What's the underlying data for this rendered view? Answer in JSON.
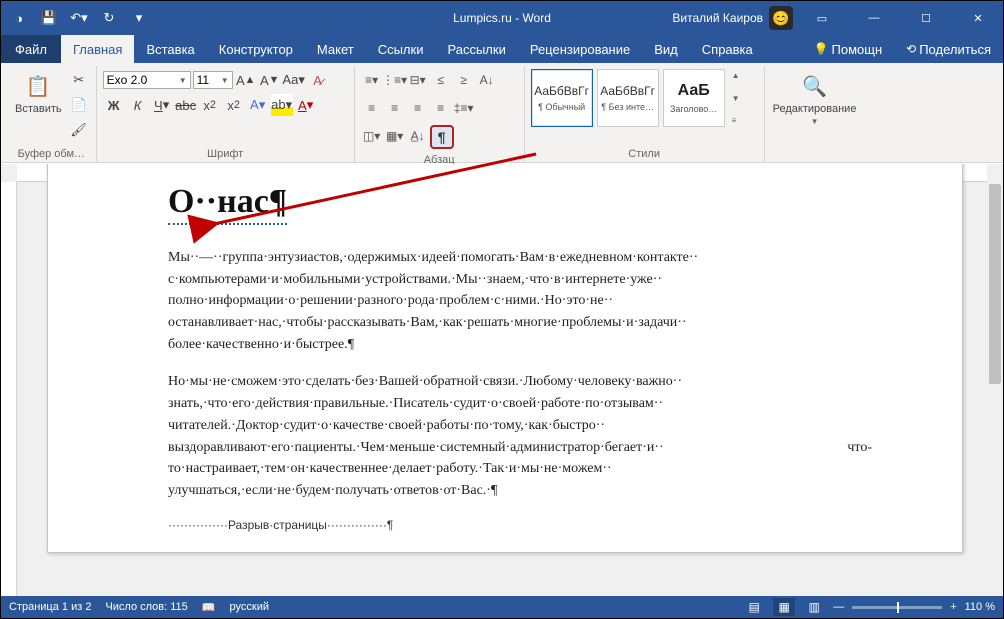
{
  "title": "Lumpics.ru  -  Word",
  "user": "Виталий Каиров",
  "tabs": {
    "file": "Файл",
    "home": "Главная",
    "insert": "Вставка",
    "design": "Конструктор",
    "layout": "Макет",
    "refs": "Ссылки",
    "mail": "Рассылки",
    "review": "Рецензирование",
    "view": "Вид",
    "help": "Справка",
    "assist": "Помощн",
    "share": "Поделиться"
  },
  "groups": {
    "clipboard": "Буфер обм…",
    "paste": "Вставить",
    "font": "Шрифт",
    "paragraph": "Абзац",
    "styles": "Стили",
    "editing": "Редактирование"
  },
  "font": {
    "name": "Exo 2.0",
    "size": "11"
  },
  "styles": {
    "preview": "АаБбВвГг",
    "normal": "¶ Обычный",
    "nospace": "¶ Без инте…",
    "h1preview": "АаБ",
    "h1": "Заголово…"
  },
  "doc": {
    "heading": "О··нас¶",
    "p1": "Мы··—··группа·энтузиастов,·одержимых·идеей·помогать·Вам·в·ежедневном·контакте·· с·компьютерами·и·мобильными·устройствами.·Мы··знаем,·что·в·интернете·уже·· полно·информации·о·решении·разного·рода·проблем·с·ними.·Но·это·не·· останавливает·нас,·чтобы·рассказывать·Вам,·как·решать·многие·проблемы·и·задачи·· более·качественно·и·быстрее.¶",
    "p2": "Но·мы·не·сможем·это·сделать·без·Вашей·обратной·связи.·Любому·человеку·важно·· знать,·что·его·действия·правильные.·Писатель·судит·о·своей·работе·по·отзывам·· читателей.·Доктор·судит·о·качестве·своей·работы·по·тому,·как·быстро·· выздоравливают·его·пациенты.·Чем·меньше·системный·администратор·бегает·и·· что-то·настраивает,·тем·он·качественнее·делает·работу.·Так·и·мы·не·можем·· улучшаться,·если·не·будем·получать·ответов·от·Вас.·¶",
    "pagebreak": "···············Разрыв·страницы···············¶"
  },
  "status": {
    "page": "Страница 1 из 2",
    "words": "Число слов: 115",
    "lang": "русский",
    "zoom": "110 %"
  }
}
